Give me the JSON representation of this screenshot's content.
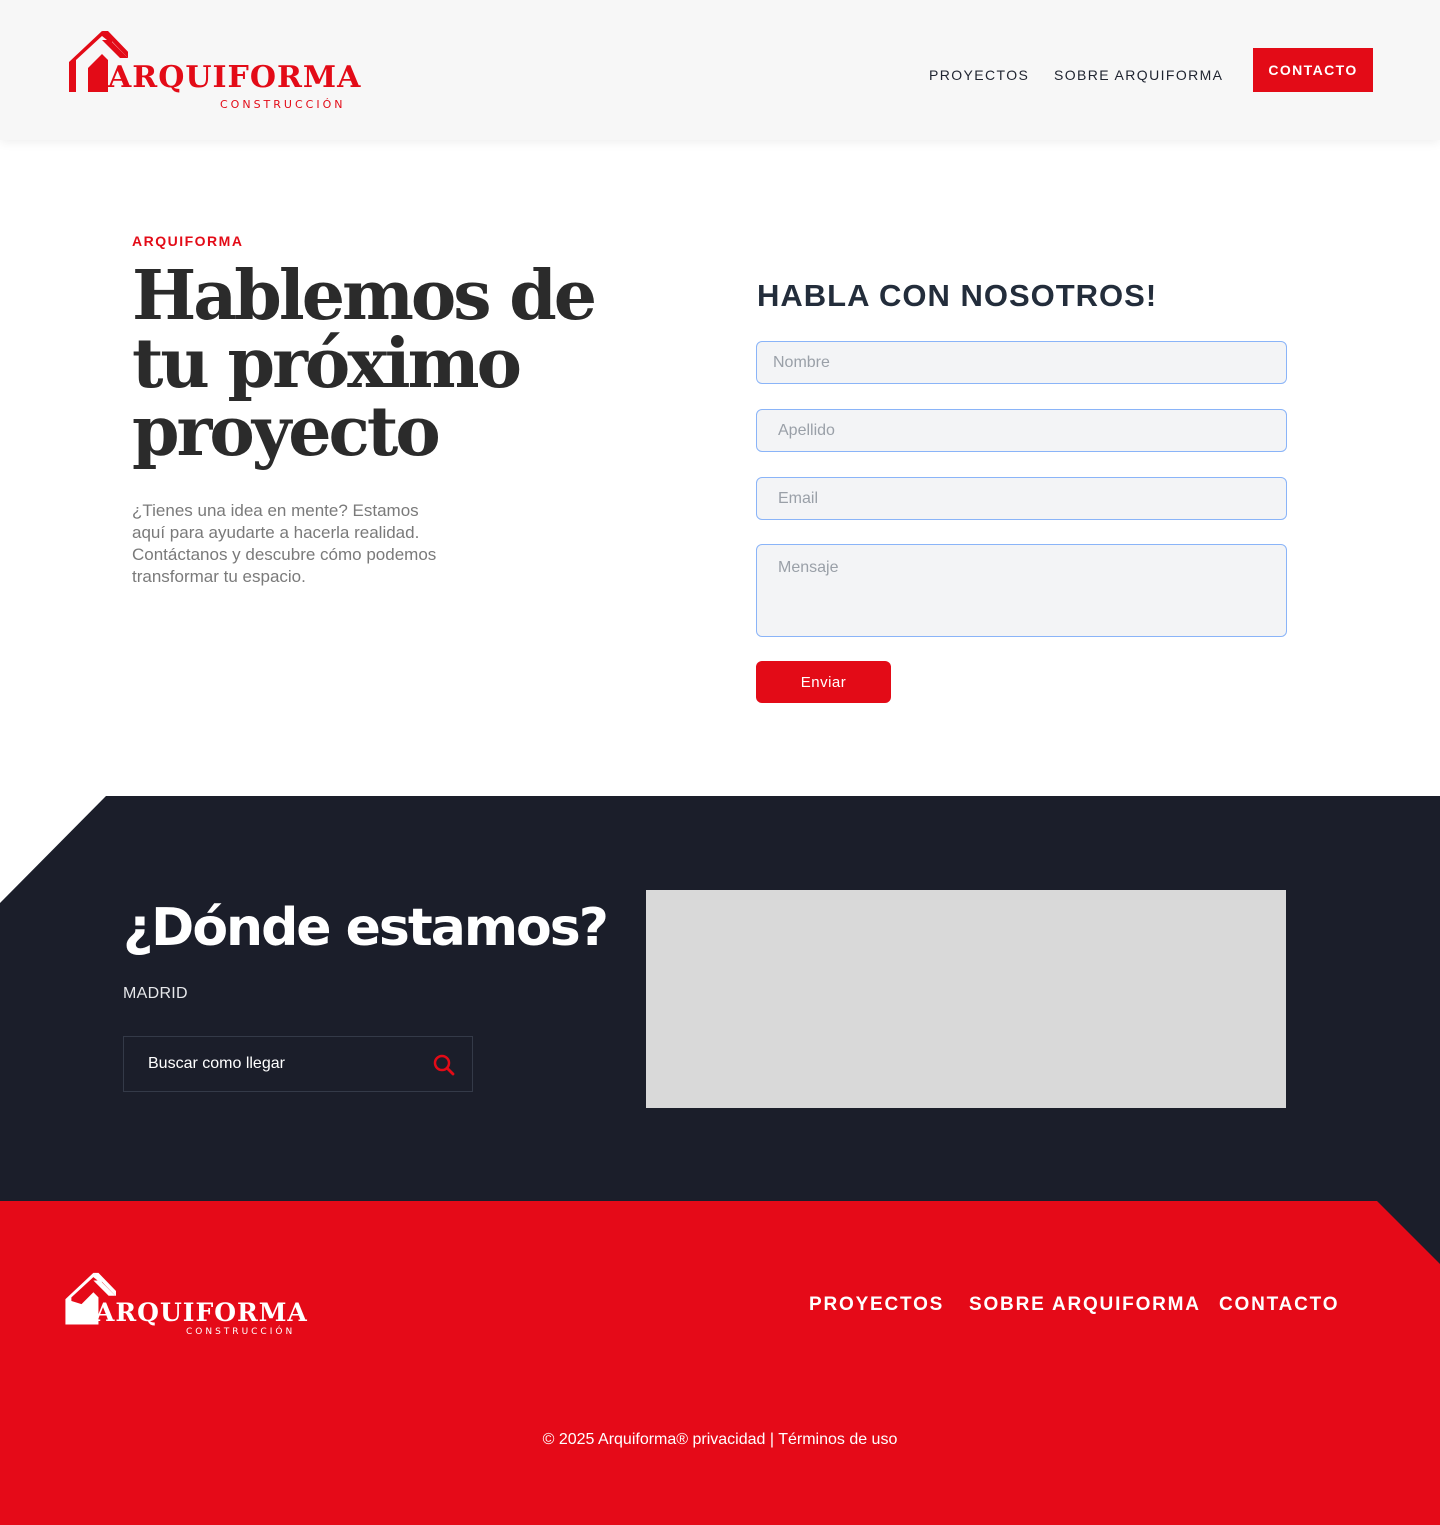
{
  "colors": {
    "brand_red": "#e30b17",
    "dark": "#1b1e2a",
    "header_bg": "#f7f7f7",
    "map_placeholder": "#d9d9d9"
  },
  "header": {
    "logo_word": "ARQUIFORMA",
    "logo_sub": "CONSTRUCCIÓN",
    "nav": {
      "proyectos": "PROYECTOS",
      "sobre": "SOBRE ARQUIFORMA",
      "contacto": "CONTACTO"
    }
  },
  "hero": {
    "eyebrow": "ARQUIFORMA",
    "title": "Hablemos de tu próximo proyecto",
    "text": "¿Tienes una idea en mente? Estamos aquí para ayudarte a hacerla realidad. Contáctanos y descubre cómo podemos transformar tu espacio."
  },
  "form": {
    "title": "HABLA CON NOSOTROS!",
    "nombre_placeholder": "Nombre",
    "apellido_placeholder": "Apellido",
    "email_placeholder": "Email",
    "mensaje_placeholder": "Mensaje",
    "submit_label": "Enviar"
  },
  "location": {
    "title": "¿Dónde estamos?",
    "city": "MADRID",
    "search_label": "Buscar como llegar",
    "search_icon": "search-icon"
  },
  "footer": {
    "logo_word": "ARQUIFORMA",
    "logo_sub": "CONSTRUCCIÓN",
    "nav": {
      "proyectos": "PROYECTOS",
      "sobre": "SOBRE ARQUIFORMA",
      "contacto": "CONTACTO"
    },
    "copyright": "© 2025 Arquiforma® privacidad | Términos de uso"
  }
}
